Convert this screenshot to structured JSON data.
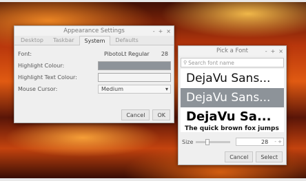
{
  "appearance": {
    "title": "Appearance Settings",
    "tabs": [
      "Desktop",
      "Taskbar",
      "System",
      "Defaults"
    ],
    "font_label": "Font:",
    "font_name": "PibotoLt Regular",
    "font_size": "28",
    "highlight_label": "Highlight Colour:",
    "highlight_color": "#8d9399",
    "highlight_text_label": "Highlight Text Colour:",
    "highlight_text_color": "#f4f4f4",
    "cursor_label": "Mouse Cursor:",
    "cursor_value": "Medium",
    "cancel": "Cancel",
    "ok": "OK"
  },
  "pickfont": {
    "title": "Pick a Font",
    "search_placeholder": "Search font name",
    "previews": [
      "DejaVu Sans...",
      "DejaVu Sans...",
      "DejaVu Sa...",
      "The quick brown fox jumps"
    ],
    "size_label": "Size",
    "size_value": "28",
    "cancel": "Cancel",
    "select": "Select"
  },
  "icons": {
    "minimize": "-",
    "maximize": "+",
    "close": "×",
    "dropdown": "▾",
    "spin_down": "-",
    "spin_up": "+"
  }
}
